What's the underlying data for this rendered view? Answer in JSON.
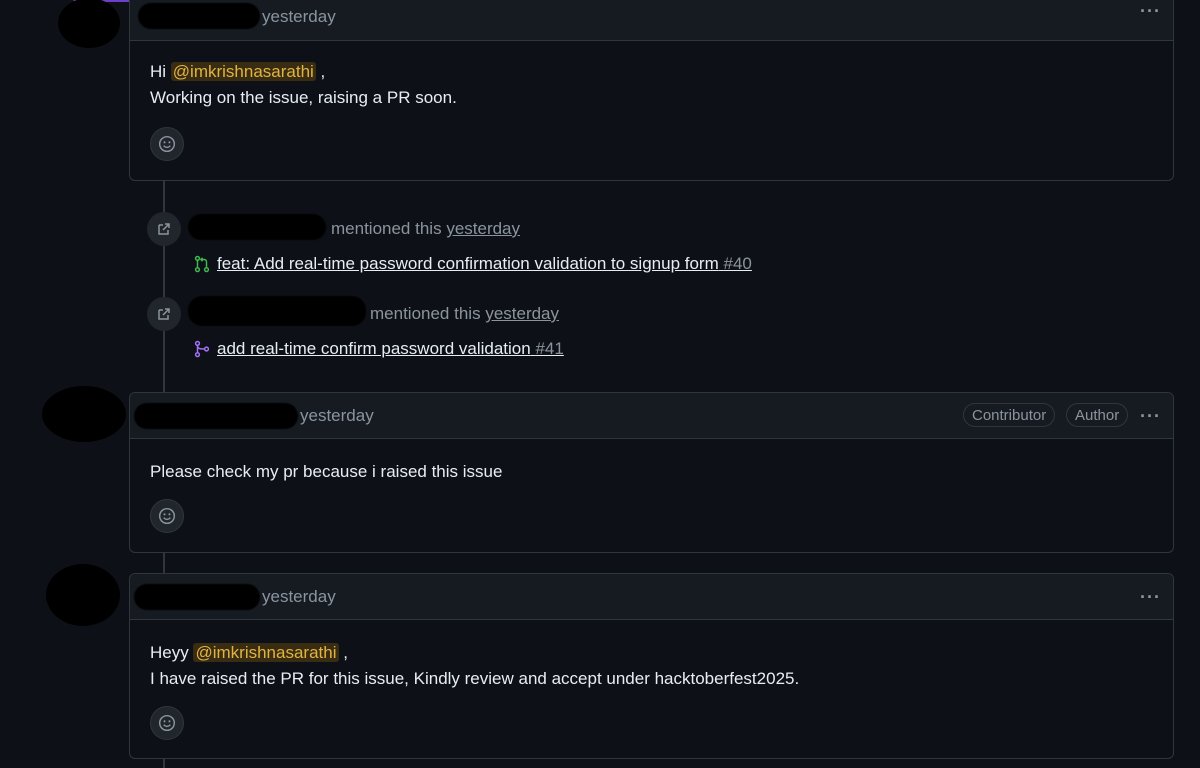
{
  "comments": [
    {
      "timestamp": "yesterday",
      "body_lines": [
        {
          "prefix": "Hi ",
          "mention": "@imkrishnasarathi",
          "suffix": " ,"
        },
        {
          "text": "Working on the issue, raising a PR soon."
        }
      ]
    },
    {
      "timestamp": "yesterday",
      "labels": [
        "Contributor",
        "Author"
      ],
      "body_lines": [
        {
          "text": "Please check my pr because i raised this issue"
        }
      ]
    },
    {
      "timestamp": "yesterday",
      "body_lines": [
        {
          "prefix": "Heyy ",
          "mention": "@imkrishnasarathi",
          "suffix": " ,"
        },
        {
          "text": "I have raised the PR for this issue, Kindly review and accept under hacktoberfest2025."
        }
      ]
    }
  ],
  "events": [
    {
      "action": "mentioned this",
      "time": "yesterday",
      "pr_title": "feat: Add real-time password confirmation validation to signup form",
      "pr_number": "#40",
      "pr_state_color": "#3fb950"
    },
    {
      "action": "mentioned this",
      "time": "yesterday",
      "pr_title": "add real-time confirm password validation",
      "pr_number": "#41",
      "pr_state_color": "#a371f7"
    }
  ],
  "icons": {
    "reaction": "smiley-icon",
    "event": "cross-reference-icon",
    "open_pr": "git-pull-request-icon",
    "merged_pr": "git-merge-icon",
    "menu": "kebab-icon"
  },
  "menu_glyph": "···"
}
